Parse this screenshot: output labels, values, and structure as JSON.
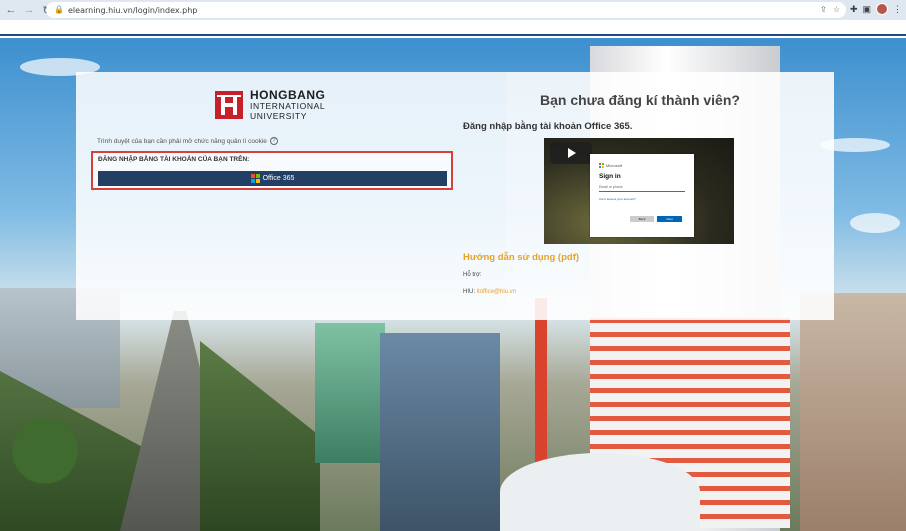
{
  "browser": {
    "url": "elearning.hiu.vn/login/index.php"
  },
  "logo": {
    "line1": "HONGBANG",
    "line2": "INTERNATIONAL",
    "line3": "UNIVERSITY",
    "brand_color": "#c8202a"
  },
  "login": {
    "cookie_note": "Trình duyệt của bạn cần phải mở chức năng quản lí cookie",
    "section_label": "ĐĂNG NHẬP BẰNG TÀI KHOẢN CỦA BẠN TRÊN:",
    "office_button_label": "Office 365",
    "button_color": "#233f64",
    "highlight_color": "#d6413c"
  },
  "right": {
    "title": "Bạn chưa đăng kí thành viên?",
    "o365_heading": "Đăng nhập bằng tài khoản Office 365.",
    "video": {
      "brand": "Microsoft",
      "title": "Sign in",
      "input_placeholder": "Email or phone",
      "link": "Can't access your account?",
      "back_label": "Back",
      "next_label": "Next"
    },
    "guide_heading": "Hướng dẫn sử dụng (pdf)",
    "support_label": "Hỗ trợ:",
    "hiu_label": "HIU:",
    "hiu_email": "itoffice@hiu.vn",
    "accent_color": "#e8a224"
  }
}
